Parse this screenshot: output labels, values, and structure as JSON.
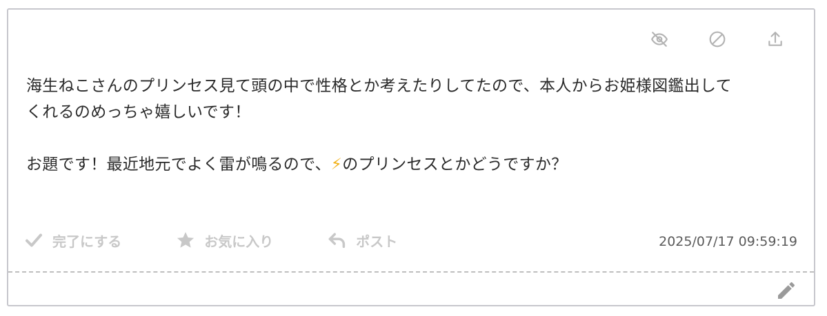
{
  "message": {
    "line1": "海生ねこさんのプリンセス見て頭の中で性格とか考えたりしてたので、本人からお姫様図鑑出して",
    "line2": "くれるのめっちゃ嬉しいです！",
    "line3_before": "お題です！最近地元でよく雷が鳴るので、",
    "line3_emoji": "⚡",
    "line3_after": "のプリンセスとかどうですか？"
  },
  "actions": {
    "complete_label": "完了にする",
    "favorite_label": "お気に入り",
    "post_label": "ポスト"
  },
  "timestamp": "2025/07/17 09:59:19",
  "icons": {
    "top": [
      "eye-off-icon",
      "block-icon",
      "upload-icon"
    ],
    "actions": [
      "check-icon",
      "star-icon",
      "reply-icon"
    ],
    "footer": "pencil-icon"
  },
  "colors": {
    "icon_gray": "#b3b3b3",
    "action_gray": "#c8c8c8",
    "text": "#2a2a2a",
    "bolt": "#f2b21a",
    "border": "#c6c6cc"
  }
}
